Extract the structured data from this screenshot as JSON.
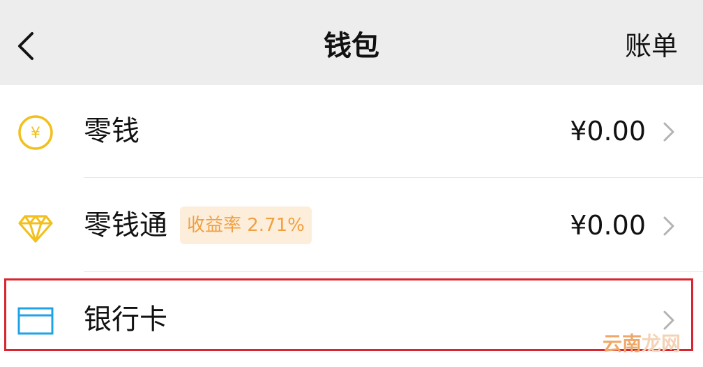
{
  "header": {
    "title": "钱包",
    "back_icon": "chevron-left-icon",
    "bill_label": "账单"
  },
  "list": {
    "items": [
      {
        "icon": "yuan-coin-icon",
        "label": "零钱",
        "amount": "¥0.00",
        "badge": ""
      },
      {
        "icon": "diamond-icon",
        "label": "零钱通",
        "badge": "收益率 2.71%",
        "amount": "¥0.00"
      },
      {
        "icon": "bank-card-icon",
        "label": "银行卡",
        "amount": "",
        "badge": ""
      }
    ]
  },
  "watermark": {
    "part1": "云南",
    "part2": "龙网"
  },
  "colors": {
    "header_bg": "#ededed",
    "coin_yellow": "#f2c01e",
    "card_blue": "#1fa3e8",
    "badge_bg": "#fdeedc",
    "badge_text": "#f0a040",
    "highlight_red": "#d9252f"
  }
}
